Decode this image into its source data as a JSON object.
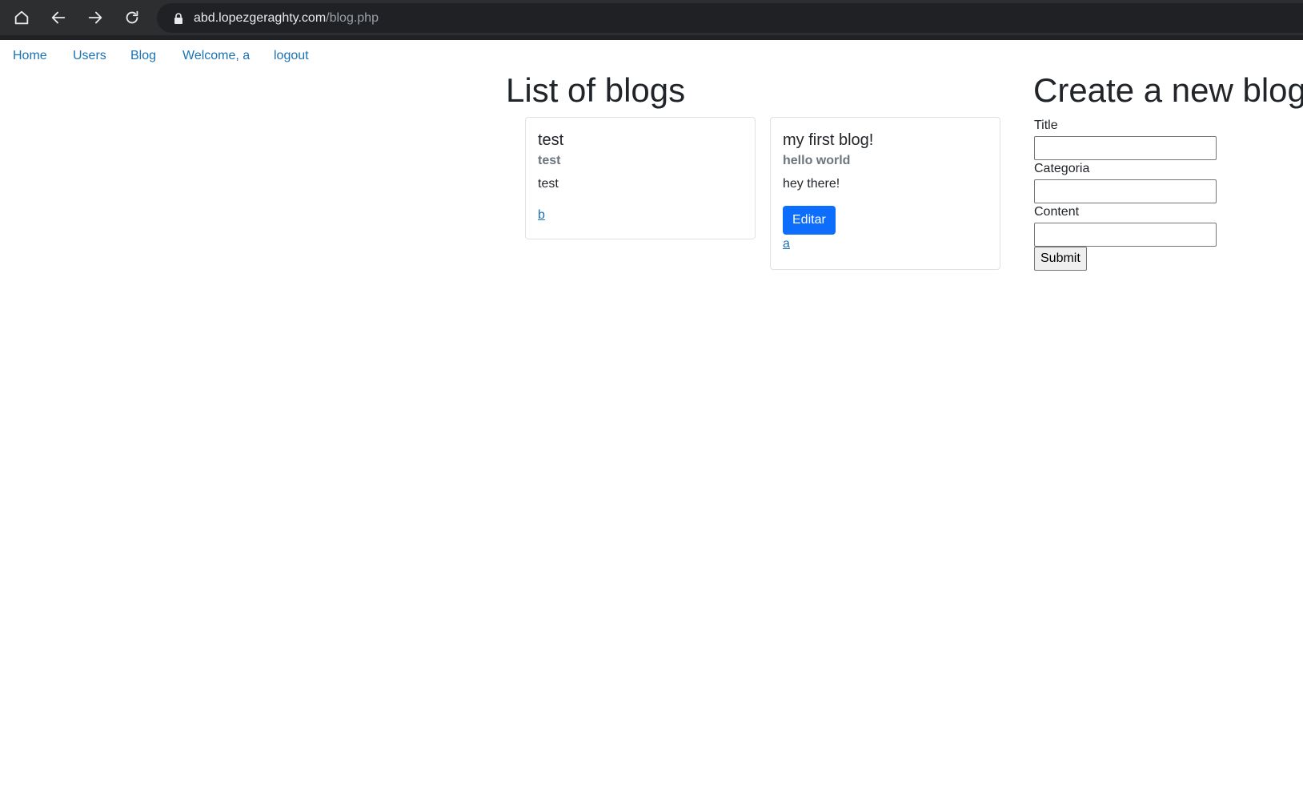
{
  "browser": {
    "url_domain": "abd.lopezgeraghty.com",
    "url_path": "/blog.php",
    "icons": [
      "home-icon",
      "back-icon",
      "forward-icon",
      "reload-icon",
      "lock-icon"
    ]
  },
  "nav": {
    "home": "Home",
    "users": "Users",
    "blog": "Blog",
    "welcome": "Welcome, a",
    "logout": "logout"
  },
  "blogs": {
    "heading": "List of blogs",
    "items": [
      {
        "title": "test",
        "category": "test",
        "content": "test",
        "author": "b"
      },
      {
        "title": "my first blog!",
        "category": "hello world",
        "content": "hey there!",
        "edit_label": "Editar",
        "author": "a"
      }
    ]
  },
  "create": {
    "heading": "Create a new blog",
    "title_label": "Title",
    "title_value": "",
    "category_label": "Categoria",
    "category_value": "",
    "content_label": "Content",
    "content_value": "",
    "submit_label": "Submit"
  },
  "colors": {
    "link": "#1a73b5",
    "primary": "#0d6efd",
    "chrome_bg": "#2d2e30"
  }
}
